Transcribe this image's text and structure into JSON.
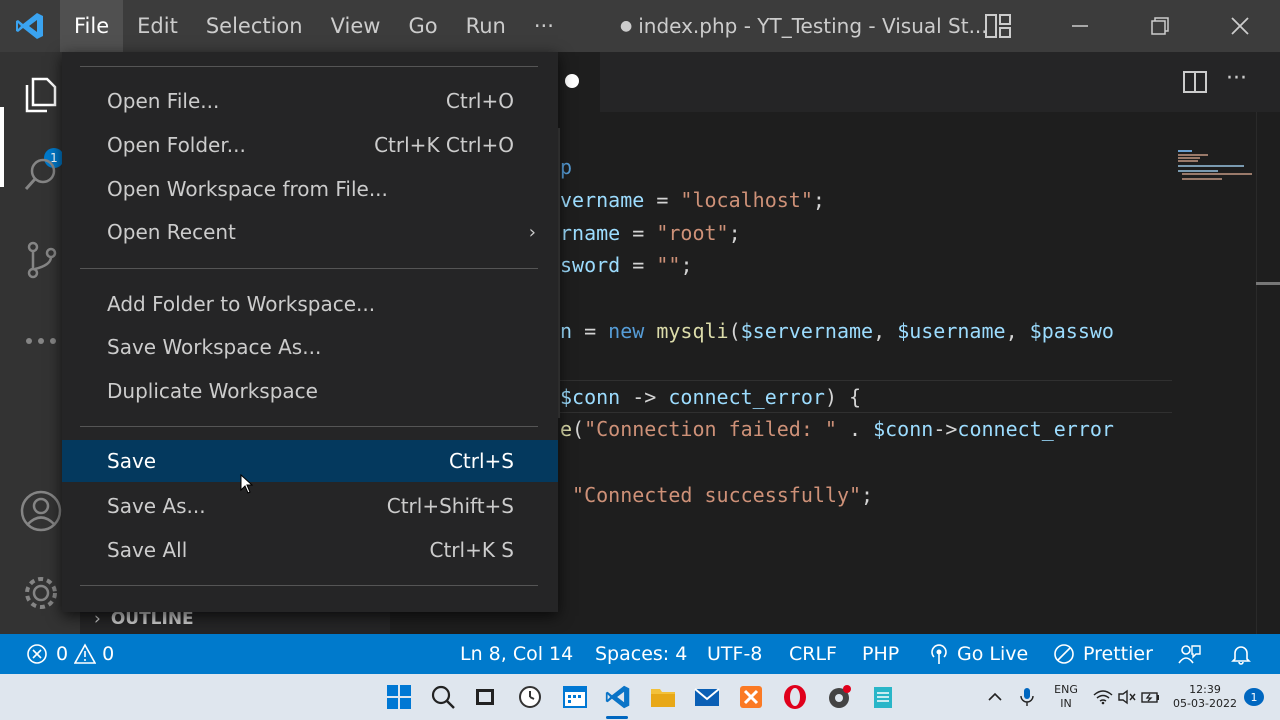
{
  "titlebar": {
    "menus": [
      "File",
      "Edit",
      "Selection",
      "View",
      "Go",
      "Run",
      "···"
    ],
    "title": "index.php - YT_Testing - Visual St...",
    "title_dot": "●"
  },
  "activity": {
    "explorer_badge": "1"
  },
  "editor": {
    "lines": [
      {
        "parts": [
          {
            "t": "p",
            "c": "kw"
          }
        ]
      },
      {
        "parts": [
          {
            "t": "vername",
            "c": "var"
          },
          {
            "t": " = ",
            "c": "op"
          },
          {
            "t": "\"localhost\"",
            "c": "str"
          },
          {
            "t": ";",
            "c": "op"
          }
        ]
      },
      {
        "parts": [
          {
            "t": "rname",
            "c": "var"
          },
          {
            "t": " = ",
            "c": "op"
          },
          {
            "t": "\"root\"",
            "c": "str"
          },
          {
            "t": ";",
            "c": "op"
          }
        ]
      },
      {
        "parts": [
          {
            "t": "sword",
            "c": "var"
          },
          {
            "t": " = ",
            "c": "op"
          },
          {
            "t": "\"\"",
            "c": "str"
          },
          {
            "t": ";",
            "c": "op"
          }
        ]
      },
      {
        "parts": []
      },
      {
        "parts": [
          {
            "t": "n",
            "c": "var"
          },
          {
            "t": " = ",
            "c": "op"
          },
          {
            "t": "new",
            "c": "kw"
          },
          {
            "t": " ",
            "c": "op"
          },
          {
            "t": "mysqli",
            "c": "fn"
          },
          {
            "t": "(",
            "c": "op"
          },
          {
            "t": "$servername",
            "c": "var"
          },
          {
            "t": ", ",
            "c": "op"
          },
          {
            "t": "$username",
            "c": "var"
          },
          {
            "t": ", ",
            "c": "op"
          },
          {
            "t": "$passwo",
            "c": "var"
          }
        ]
      },
      {
        "parts": []
      },
      {
        "parts": [
          {
            "t": "$conn",
            "c": "var"
          },
          {
            "t": " -> ",
            "c": "op"
          },
          {
            "t": "connect_error",
            "c": "var"
          },
          {
            "t": ") {",
            "c": "op"
          }
        ]
      },
      {
        "parts": [
          {
            "t": "e",
            "c": "fn"
          },
          {
            "t": "(",
            "c": "op"
          },
          {
            "t": "\"Connection failed: \"",
            "c": "str"
          },
          {
            "t": " . ",
            "c": "op"
          },
          {
            "t": "$conn",
            "c": "var"
          },
          {
            "t": "->",
            "c": "op"
          },
          {
            "t": "connect_error",
            "c": "var"
          }
        ]
      },
      {
        "parts": []
      },
      {
        "parts": [
          {
            "t": " ",
            "c": "op"
          },
          {
            "t": "\"Connected successfully\"",
            "c": "str"
          },
          {
            "t": ";",
            "c": "op"
          }
        ]
      }
    ]
  },
  "file_menu": {
    "items": [
      {
        "label": "Open File...",
        "shortcut": "Ctrl+O"
      },
      {
        "label": "Open Folder...",
        "shortcut": "Ctrl+K Ctrl+O"
      },
      {
        "label": "Open Workspace from File...",
        "shortcut": ""
      },
      {
        "label": "Open Recent",
        "shortcut": ""
      },
      {
        "label": "Add Folder to Workspace...",
        "shortcut": ""
      },
      {
        "label": "Save Workspace As...",
        "shortcut": ""
      },
      {
        "label": "Duplicate Workspace",
        "shortcut": ""
      },
      {
        "label": "Save",
        "shortcut": "Ctrl+S"
      },
      {
        "label": "Save As...",
        "shortcut": "Ctrl+Shift+S"
      },
      {
        "label": "Save All",
        "shortcut": "Ctrl+K S"
      }
    ],
    "highlighted": "Save"
  },
  "sidebar": {
    "outline_label": "OUTLINE"
  },
  "statusbar": {
    "errors": "0",
    "warnings": "0",
    "position": "Ln 8, Col 14",
    "spaces": "Spaces: 4",
    "encoding": "UTF-8",
    "eol": "CRLF",
    "language": "PHP",
    "go_live": "Go Live",
    "prettier": "Prettier"
  },
  "taskbar": {
    "lang_top": "ENG",
    "lang_bottom": "IN",
    "time": "12:39",
    "date": "05-03-2022",
    "notif_count": "1"
  },
  "colors": {
    "accent": "#007acc",
    "menu_highlight": "#04395e",
    "titlebar": "#3c3c3c"
  }
}
